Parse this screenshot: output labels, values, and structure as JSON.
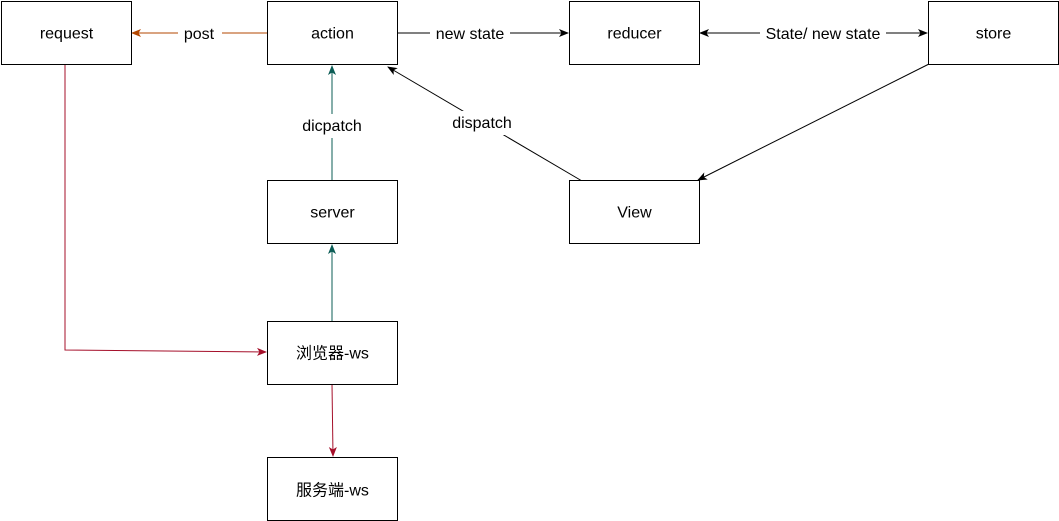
{
  "nodes": {
    "request": "request",
    "action": "action",
    "reducer": "reducer",
    "store": "store",
    "server": "server",
    "view": "View",
    "browser_ws": "浏览器-ws",
    "server_ws": "服务端-ws"
  },
  "edges": {
    "post": "post",
    "new_state": "new state",
    "state_new_state": "State/ new state",
    "dicpatch": "dicpatch",
    "dispatch": "dispatch"
  },
  "colors": {
    "black": "#000000",
    "orange": "#B34700",
    "teal": "#0B5C55",
    "red": "#A50F2A"
  }
}
